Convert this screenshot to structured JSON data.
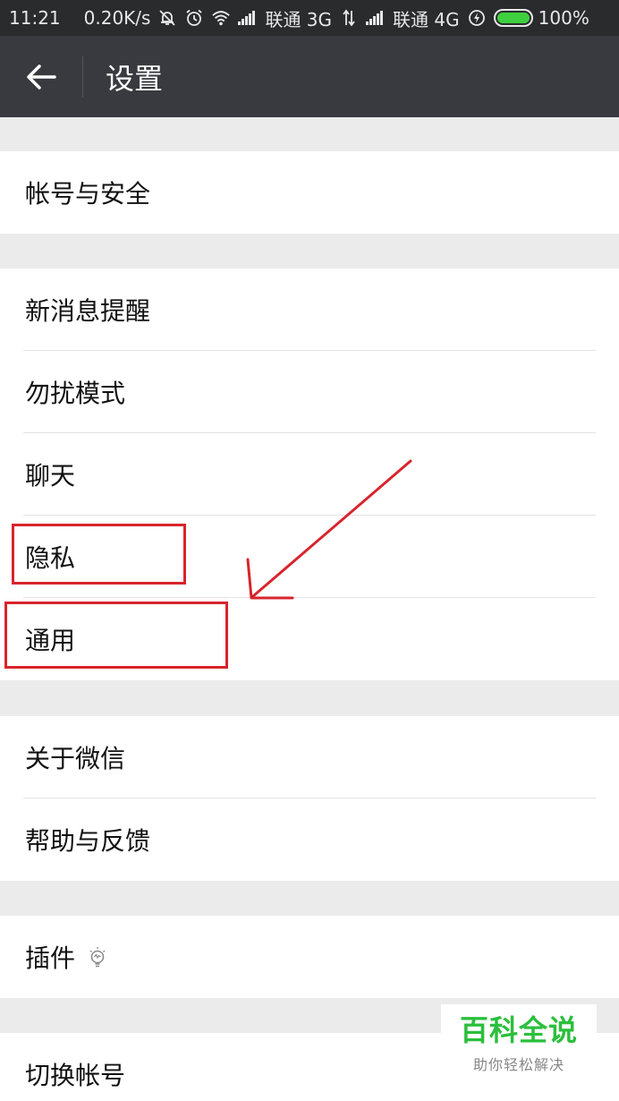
{
  "status_bar": {
    "time": "11:21",
    "speed": "0.20K/s",
    "carrier1": "联通 3G",
    "carrier2": "联通 4G",
    "battery": "100%",
    "icons": [
      "bell-off-icon",
      "alarm-icon",
      "wifi-icon",
      "signal-icon",
      "data-transfer-icon",
      "signal-icon",
      "charging-icon",
      "battery-icon"
    ],
    "battery_color": "#3fd03f"
  },
  "toolbar": {
    "title": "设置",
    "back_icon": "arrow-left-icon"
  },
  "groups": [
    {
      "items": [
        "帐号与安全"
      ]
    },
    {
      "items": [
        "新消息提醒",
        "勿扰模式",
        "聊天",
        "隐私",
        "通用"
      ]
    },
    {
      "items": [
        "关于微信",
        "帮助与反馈"
      ]
    },
    {
      "items": [
        "插件"
      ],
      "plugin_icon": "lightbulb-icon"
    },
    {
      "items": [
        "切换帐号"
      ]
    }
  ],
  "annotations": {
    "highlight_color": "#d8242c",
    "highlighted_items": [
      "隐私",
      "通用"
    ],
    "arrow_target": "通用"
  },
  "watermark": {
    "main": "百科全说",
    "sub": "助你轻松解决",
    "color": "#2bbf3c"
  }
}
